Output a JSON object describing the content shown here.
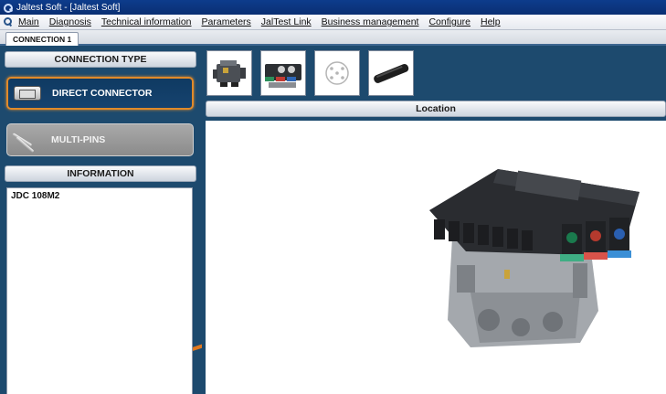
{
  "window": {
    "title": "Jaltest Soft - [Jaltest Soft]"
  },
  "menu": {
    "items": [
      "Main",
      "Diagnosis",
      "Technical information",
      "Parameters",
      "JalTest Link",
      "Business management",
      "Configure",
      "Help"
    ]
  },
  "tabs": [
    {
      "label": "CONNECTION 1",
      "active": true
    }
  ],
  "connection_type": {
    "header": "CONNECTION TYPE",
    "options": [
      {
        "label": "DIRECT CONNECTOR",
        "icon": "connector-icon",
        "selected": true
      },
      {
        "label": "MULTI-PINS",
        "icon": "multi-pins-icon",
        "selected": false
      }
    ]
  },
  "information": {
    "header": "INFORMATION",
    "content": "JDC 108M2"
  },
  "thumbnails": [
    {
      "icon": "engine-icon"
    },
    {
      "icon": "ecu-module-icon"
    },
    {
      "icon": "connector-pinout-icon"
    },
    {
      "icon": "cable-icon"
    }
  ],
  "location": {
    "header": "Location",
    "image_icon": "valve-module-icon"
  },
  "colors": {
    "accent": "#e08a2a",
    "panel_bg": "#1d4a6e",
    "titlebar": "#0d3c8c"
  }
}
